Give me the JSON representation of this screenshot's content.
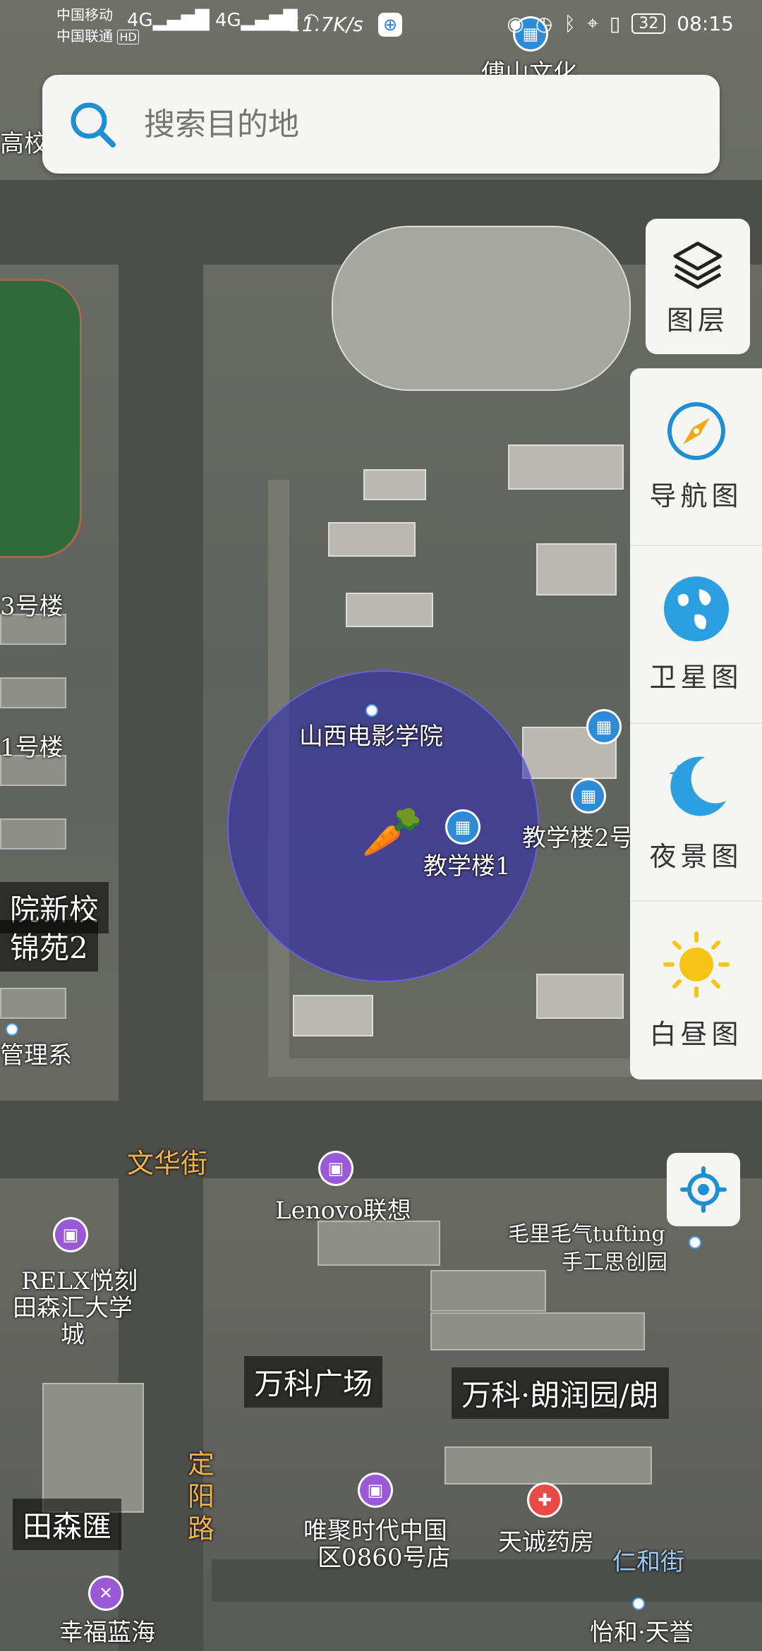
{
  "status_bar": {
    "carrier1": "中国移动",
    "carrier2": "中国联通",
    "hd": "HD",
    "signal": "4G",
    "net_speed": "11.7K/s",
    "battery": "32",
    "time": "08:15"
  },
  "search": {
    "placeholder": "搜索目的地"
  },
  "controls": {
    "layers_label": "图层",
    "modes": [
      {
        "label": "导航图",
        "icon": "compass-icon"
      },
      {
        "label": "卫星图",
        "icon": "globe-icon"
      },
      {
        "label": "夜景图",
        "icon": "moon-icon"
      },
      {
        "label": "白昼图",
        "icon": "sun-icon"
      }
    ]
  },
  "map_labels": {
    "top_culture": "傅山文化",
    "gaoxiao": "高校",
    "bldg3": "3号楼",
    "bldg1_left": "1号楼",
    "school_new": "院新校",
    "jinyuan": "锦苑2",
    "management": "管理系",
    "film_academy": "山西电影学院",
    "teach1": "教学楼1",
    "teach2": "教学楼2号",
    "wenhua_st": "文华街",
    "lenovo": "Lenovo联想",
    "maoli": "毛里毛气tufting",
    "maoli2": "手工思创园",
    "relx1": "RELX悦刻",
    "relx2": "田森汇大学",
    "relx3": "城",
    "vanke_plaza": "万科广场",
    "vanke_garden": "万科·朗润园/朗",
    "dingyang1": "定",
    "dingyang2": "阳",
    "dingyang3": "路",
    "tiansen": "田森匯",
    "weiju1": "唯聚时代中国",
    "weiju2": "区0860号店",
    "tiancheng": "天诚药房",
    "renhe": "仁和街",
    "xingfu": "幸福蓝海",
    "yihe": "怡和·天誉"
  }
}
